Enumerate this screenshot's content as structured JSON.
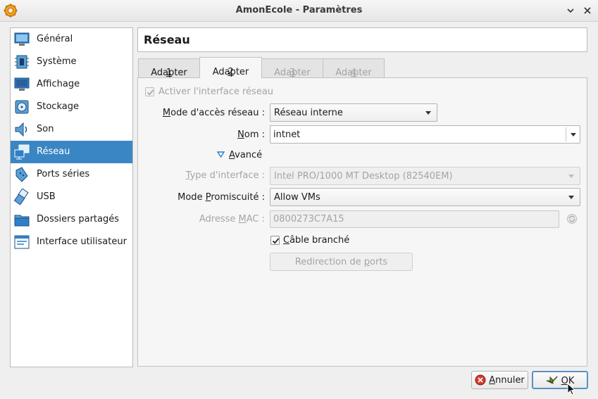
{
  "window": {
    "title": "AmonEcole - Paramètres"
  },
  "sidebar": {
    "items": [
      {
        "label": "Général",
        "icon": "general-monitor-icon"
      },
      {
        "label": "Système",
        "icon": "chip-icon"
      },
      {
        "label": "Affichage",
        "icon": "display-icon"
      },
      {
        "label": "Stockage",
        "icon": "storage-icon"
      },
      {
        "label": "Son",
        "icon": "speaker-icon"
      },
      {
        "label": "Réseau",
        "icon": "network-icon",
        "selected": true
      },
      {
        "label": "Ports séries",
        "icon": "serial-port-icon"
      },
      {
        "label": "USB",
        "icon": "usb-icon"
      },
      {
        "label": "Dossiers partagés",
        "icon": "folder-icon"
      },
      {
        "label": "Interface utilisateur",
        "icon": "user-interface-icon"
      }
    ]
  },
  "page": {
    "title": "Réseau"
  },
  "tabs": [
    {
      "label_pre": "Adapter ",
      "label_key": "1",
      "enabled": true,
      "active": false
    },
    {
      "label_pre": "Adapter ",
      "label_key": "2",
      "enabled": true,
      "active": true
    },
    {
      "label_pre": "Adapter ",
      "label_key": "3",
      "enabled": false,
      "active": false
    },
    {
      "label_pre": "Adapter ",
      "label_key": "4",
      "enabled": false,
      "active": false
    }
  ],
  "form": {
    "enable_adapter": {
      "label": "Activer l'interface réseau",
      "checked": true,
      "enabled": false
    },
    "attachment": {
      "label_key": "M",
      "label_rest": "ode d'accès réseau :",
      "value": "Réseau interne"
    },
    "name": {
      "label_key": "N",
      "label_rest": "om :",
      "value": "intnet"
    },
    "advanced": {
      "label_key": "A",
      "label_rest": "vancé",
      "expanded": true
    },
    "adapter_type": {
      "label_key": "T",
      "label_rest": "ype d'interface :",
      "value": "Intel PRO/1000 MT Desktop (82540EM)",
      "enabled": false
    },
    "promiscuous": {
      "label_pre": "Mode ",
      "label_key": "P",
      "label_rest": "romiscuité :",
      "value": "Allow VMs"
    },
    "mac": {
      "label_pre": "Adresse ",
      "label_key": "M",
      "label_rest": "AC :",
      "value": "0800273C7A15",
      "enabled": false
    },
    "cable": {
      "label_key": "C",
      "label_rest": "âble branché",
      "checked": true
    },
    "port_forwarding": {
      "label_pre": "Redirection de ",
      "label_key": "p",
      "label_rest": "orts",
      "enabled": false
    }
  },
  "footer": {
    "cancel": {
      "label_key": "A",
      "label_rest": "nnuler"
    },
    "ok": {
      "label_key": "O",
      "label_rest": "K"
    }
  },
  "colors": {
    "selection": "#3a86c4",
    "disabled_text": "#a4a4a4",
    "default_button_border": "#5b8fc4"
  }
}
